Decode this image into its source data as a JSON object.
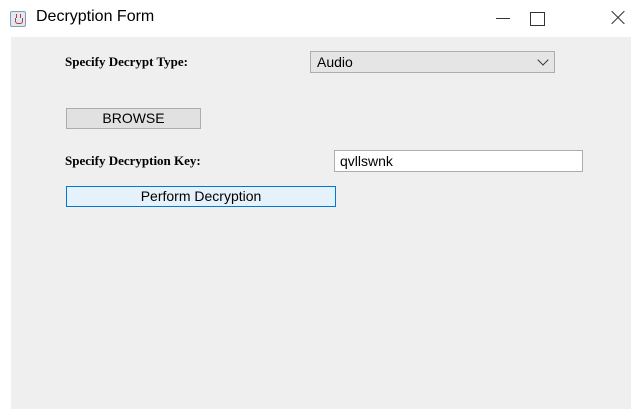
{
  "window": {
    "title": "Decryption Form",
    "icon": "java-cup-icon"
  },
  "form": {
    "decrypt_type_label": "Specify Decrypt Type:",
    "decrypt_type_value": "Audio",
    "browse_label": "BROWSE",
    "key_label": "Specify Decryption Key:",
    "key_value": "qvllswnk",
    "perform_label": "Perform Decryption"
  },
  "colors": {
    "panel_background": "#efefef",
    "button_background": "#e1e1e1",
    "focus_border": "#0078d7"
  }
}
